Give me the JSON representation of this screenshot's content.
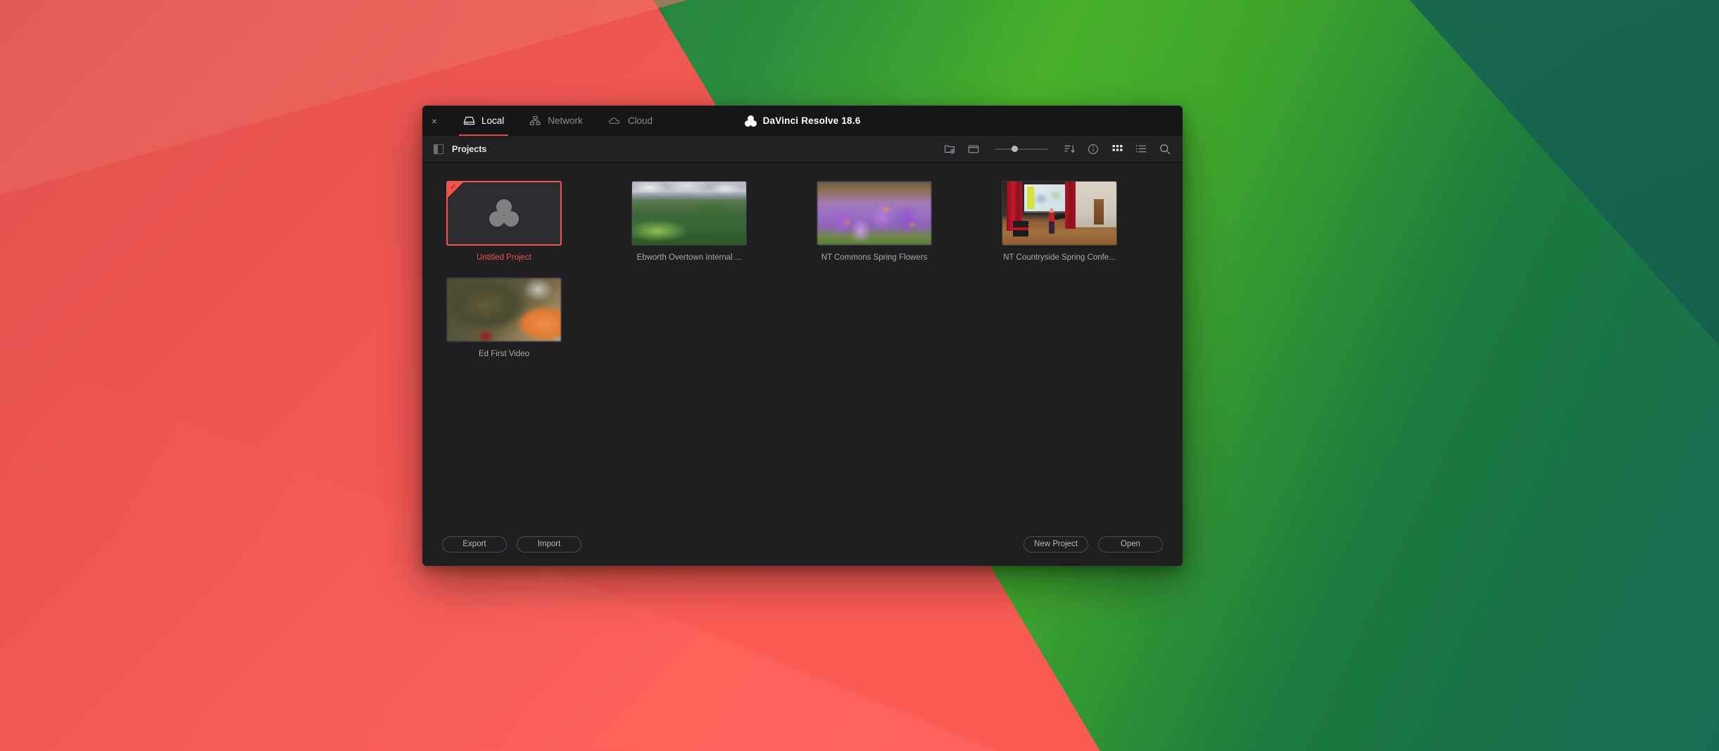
{
  "window": {
    "app_title": "DaVinci Resolve 18.6",
    "logo_icon": "resolve-logo-icon",
    "close_label": "×",
    "tabs": [
      {
        "label": "Local",
        "icon": "hard-drive-icon",
        "active": true
      },
      {
        "label": "Network",
        "icon": "network-icon",
        "active": false
      },
      {
        "label": "Cloud",
        "icon": "cloud-icon",
        "active": false
      }
    ]
  },
  "toolbar": {
    "panel_toggle_icon": "sidebar-toggle-icon",
    "title": "Projects",
    "icons": [
      {
        "name": "new-folder-icon",
        "active": false
      },
      {
        "name": "new-window-icon",
        "active": false
      },
      {
        "name": "sort-icon",
        "active": false
      },
      {
        "name": "info-icon",
        "active": false
      },
      {
        "name": "grid-view-icon",
        "active": true
      },
      {
        "name": "list-view-icon",
        "active": false
      },
      {
        "name": "search-icon",
        "active": false
      }
    ],
    "zoom_slider": {
      "name": "thumbnail-size-slider",
      "value_percent": 37
    }
  },
  "projects": [
    {
      "name": "Untitled Project",
      "selected": true,
      "thumb": "resolve-placeholder"
    },
    {
      "name": "Ebworth Overtown Internal ...",
      "selected": false,
      "thumb": "country-aerial"
    },
    {
      "name": "NT Commons Spring Flowers",
      "selected": false,
      "thumb": "purple-crocus"
    },
    {
      "name": "NT Countryside Spring Confe...",
      "selected": false,
      "thumb": "conference-hall"
    },
    {
      "name": "Ed First Video",
      "selected": false,
      "thumb": "olive-sleeve"
    }
  ],
  "footer": {
    "export_label": "Export",
    "import_label": "Import",
    "new_project_label": "New Project",
    "open_label": "Open"
  },
  "colors": {
    "accent_red": "#e8443c",
    "selection_red": "#f0544b",
    "window_bg": "#1f1f22",
    "titlebar_bg": "#161618",
    "toolbar_bg": "#212124",
    "desktop_coral": "#fb5b55",
    "desktop_green": "#49b42a"
  }
}
